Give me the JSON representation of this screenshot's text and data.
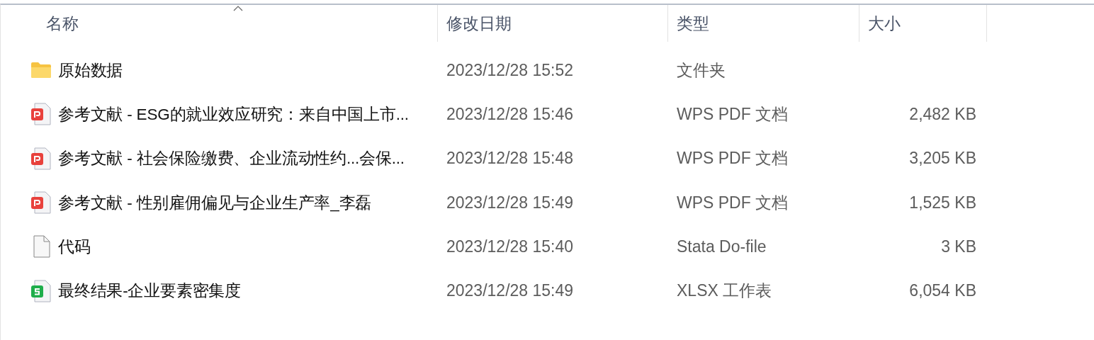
{
  "columns": [
    {
      "label": "名称",
      "sorted": true
    },
    {
      "label": "修改日期",
      "sorted": false
    },
    {
      "label": "类型",
      "sorted": false
    },
    {
      "label": "大小",
      "sorted": false
    }
  ],
  "files": [
    {
      "kind": "folder",
      "name": "原始数据",
      "modified": "2023/12/28 15:52",
      "type": "文件夹"
    },
    {
      "kind": "pdf",
      "name": "参考文献 - ESG的就业效应研究：来自中国上市...",
      "modified": "2023/12/28 15:46",
      "type": "WPS PDF 文档",
      "size": "2,482 KB"
    },
    {
      "kind": "pdf",
      "name": "参考文献 - 社会保险缴费、企业流动性约...会保...",
      "modified": "2023/12/28 15:48",
      "type": "WPS PDF 文档",
      "size": "3,205 KB"
    },
    {
      "kind": "pdf",
      "name": "参考文献 - 性别雇佣偏见与企业生产率_李磊",
      "modified": "2023/12/28 15:49",
      "type": "WPS PDF 文档",
      "size": "1,525 KB"
    },
    {
      "kind": "blank",
      "name": "代码",
      "modified": "2023/12/28 15:40",
      "type": "Stata Do-file",
      "size": "3 KB"
    },
    {
      "kind": "sheet",
      "name": "最终结果-企业要素密集度",
      "modified": "2023/12/28 15:49",
      "type": "XLSX 工作表",
      "size": "6,054 KB"
    }
  ]
}
